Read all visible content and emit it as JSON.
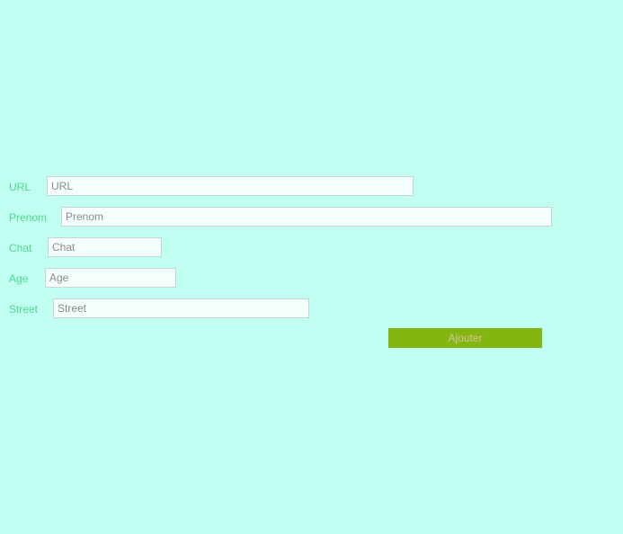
{
  "form": {
    "fields": [
      {
        "label": "URL",
        "placeholder": "URL",
        "value": ""
      },
      {
        "label": "Prenom",
        "placeholder": "Prenom",
        "value": ""
      },
      {
        "label": "Chat",
        "placeholder": "Chat",
        "value": ""
      },
      {
        "label": "Age",
        "placeholder": "Age",
        "value": ""
      },
      {
        "label": "Street",
        "placeholder": "Street",
        "value": ""
      }
    ],
    "submit_label": "Ajouter"
  },
  "colors": {
    "background": "#c0fff1",
    "label_text": "#4ed98a",
    "button_bg": "#84b612",
    "button_text": "#d6c39a"
  }
}
